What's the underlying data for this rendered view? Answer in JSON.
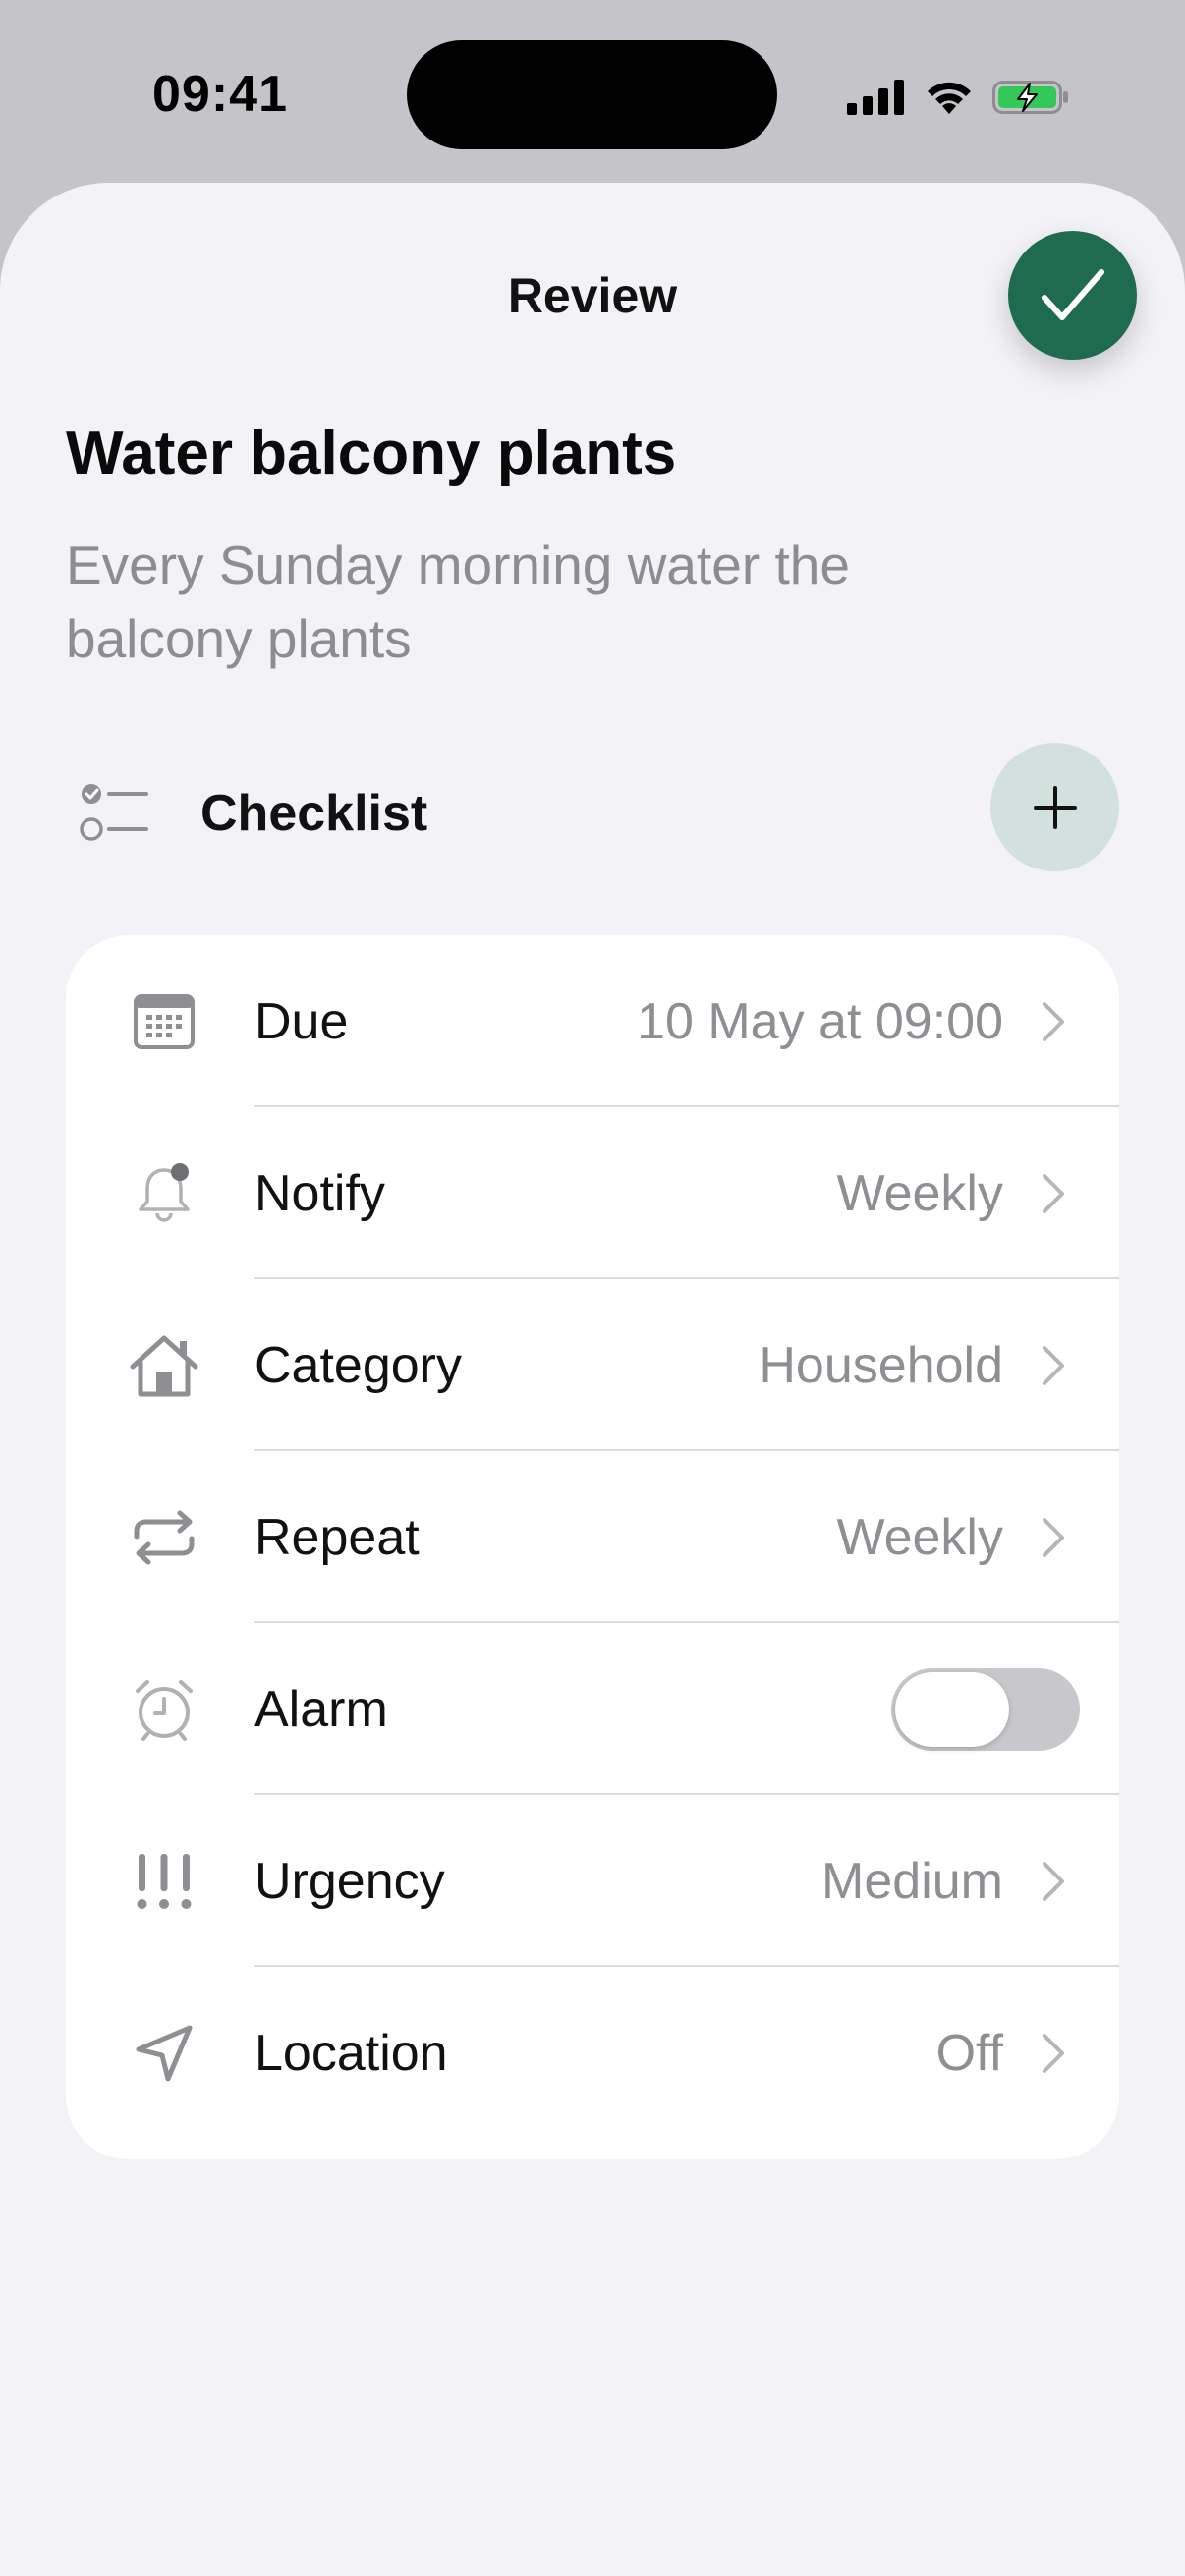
{
  "status_bar": {
    "time": "09:41"
  },
  "sheet": {
    "title": "Review",
    "done_icon": "checkmark-icon",
    "accent_color": "#1f6b4f"
  },
  "task": {
    "title": "Water balcony plants",
    "description": "Every Sunday morning water the balcony plants"
  },
  "checklist": {
    "label": "Checklist",
    "add_icon": "plus-icon"
  },
  "settings": [
    {
      "label": "Due",
      "value": "10 May at 09:00",
      "icon": "calendar-icon"
    },
    {
      "label": "Notify",
      "value": "Weekly",
      "icon": "bell-icon"
    },
    {
      "label": "Category",
      "value": "Household",
      "icon": "house-icon"
    },
    {
      "label": "Repeat",
      "value": "Weekly",
      "icon": "repeat-icon"
    },
    {
      "label": "Alarm",
      "value": "",
      "icon": "alarm-clock-icon",
      "toggle_on": false
    },
    {
      "label": "Urgency",
      "value": "Medium",
      "icon": "exclamation-icon"
    },
    {
      "label": "Location",
      "value": "Off",
      "icon": "location-arrow-icon"
    }
  ]
}
